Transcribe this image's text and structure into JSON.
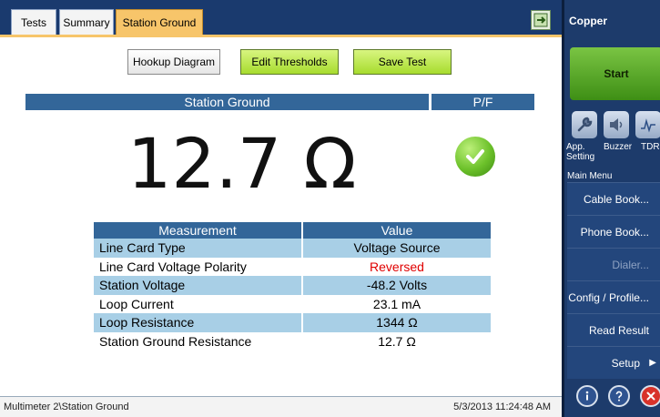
{
  "tabs": [
    {
      "label": "Tests"
    },
    {
      "label": "Summary"
    },
    {
      "label": "Station Ground"
    }
  ],
  "buttons": {
    "hookup": "Hookup Diagram",
    "thresholds": "Edit Thresholds",
    "save": "Save Test"
  },
  "result": {
    "header": "Station Ground",
    "pf_header": "P/F",
    "value": "12.7 Ω",
    "pf_status": "pass",
    "pass_color": "#5cb82a"
  },
  "table": {
    "headers": [
      "Measurement",
      "Value"
    ],
    "rows": [
      {
        "name": "Line Card Type",
        "value": "Voltage Source"
      },
      {
        "name": "Line Card Voltage Polarity",
        "value": "Reversed",
        "color": "#e00000"
      },
      {
        "name": "Station Voltage",
        "value": "-48.2 Volts"
      },
      {
        "name": "Loop Current",
        "value": "23.1 mA"
      },
      {
        "name": "Loop Resistance",
        "value": "1344 Ω"
      },
      {
        "name": "Station Ground Resistance",
        "value": "12.7 Ω"
      }
    ]
  },
  "status": {
    "path": "Multimeter 2\\Station Ground",
    "datetime": "5/3/2013 11:24:48 AM"
  },
  "side": {
    "title": "Copper",
    "start": "Start",
    "icons": [
      {
        "name": "wrench-icon",
        "label": "App. Setting"
      },
      {
        "name": "speaker-icon",
        "label": "Buzzer"
      },
      {
        "name": "tdr-icon",
        "label": "TDR"
      }
    ],
    "menu_label": "Main Menu",
    "menu": [
      {
        "label": "Cable Book..."
      },
      {
        "label": "Phone Book..."
      },
      {
        "label": "Dialer..."
      },
      {
        "label": "Config / Profile..."
      },
      {
        "label": "Read Result File..."
      },
      {
        "label": "Setup"
      }
    ]
  },
  "colors": {
    "tab_active": "#f7c56a",
    "header_blue": "#336699",
    "row_alt": "#a8cfe6",
    "sidebar": "#1d3b6b"
  }
}
